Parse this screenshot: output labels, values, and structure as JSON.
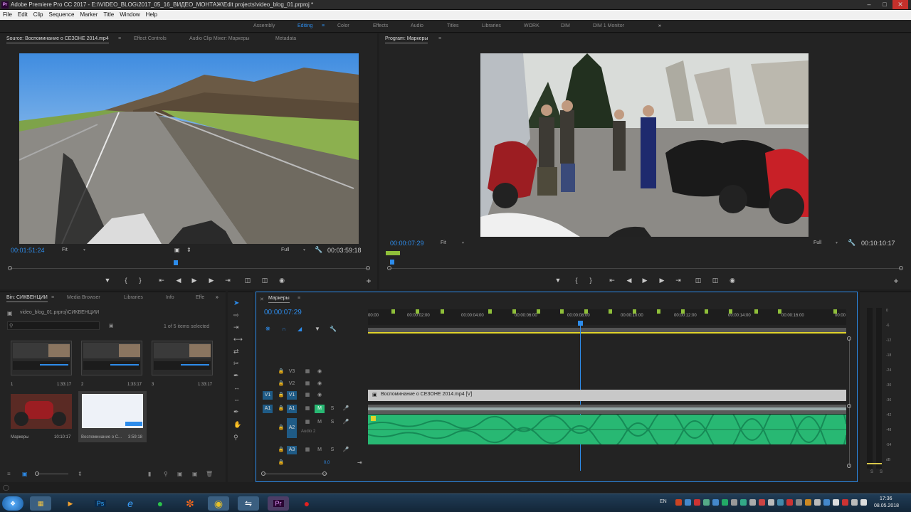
{
  "window": {
    "title": "Adobe Premiere Pro CC 2017 - E:\\\\VIDEO_BLOG\\2017_05_16_ВИДЕО_МОНТАЖ\\Edit projects\\video_blog_01.prproj *"
  },
  "menu": [
    "File",
    "Edit",
    "Clip",
    "Sequence",
    "Marker",
    "Title",
    "Window",
    "Help"
  ],
  "workspaces": [
    "Assembly",
    "Editing",
    "Color",
    "Effects",
    "Audio",
    "Titles",
    "Libraries",
    "WORK",
    "DIM",
    "DIM 1 Monitor"
  ],
  "source": {
    "tabs": [
      "Source: Воспоминание о СЕЗОНЕ 2014.mp4",
      "Effect Controls",
      "Audio Clip Mixer: Маркеры",
      "Metadata"
    ],
    "timecode": "00:01:51:24",
    "fit": "Fit",
    "quality": "Full",
    "duration": "00:03:59:18"
  },
  "program": {
    "tab": "Program: Маркеры",
    "timecode": "00:00:07:29",
    "fit": "Fit",
    "quality": "Full",
    "duration": "00:10:10:17"
  },
  "bin": {
    "tabs": [
      "Bin: СИКВЕНЦИИ",
      "Media Browser",
      "Libraries",
      "Info",
      "Effe"
    ],
    "path": "video_blog_01.prproj\\СИКВЕНЦИИ",
    "selected": "1 of 5 items selected",
    "items": [
      {
        "name": "1",
        "duration": "1:33:17"
      },
      {
        "name": "2",
        "duration": "1:33:17"
      },
      {
        "name": "3",
        "duration": "1:33:17"
      },
      {
        "name": "Маркеры",
        "duration": "10:10:17"
      },
      {
        "name": "Воспоминание о С...",
        "duration": "3:59:18"
      }
    ]
  },
  "timeline": {
    "tab": "Маркеры",
    "timecode": "00:00:07:29",
    "ruler": [
      "00:00",
      "00:00:02:00",
      "00:00:04:00",
      "00:00:06:00",
      "00:00:08:00",
      "00:00:10:00",
      "00:00:12:00",
      "00:00:14:00",
      "00:00:16:00",
      "00:00"
    ],
    "video_tracks": [
      "V3",
      "V2",
      "V1"
    ],
    "audio_tracks": [
      "A1",
      "A2",
      "A3"
    ],
    "v1_src": "V1",
    "a1_src": "A1",
    "clip_name": "Воспоминание о СЕЗОНЕ 2014.mp4 [V]",
    "audio2_name": "Audio 2",
    "m_label": "M",
    "s_label": "S",
    "master_value": "0,0"
  },
  "meter": {
    "scale": [
      "0",
      "-6",
      "-12",
      "-18",
      "-24",
      "-30",
      "-36",
      "-42",
      "-48",
      "-54",
      "dB"
    ],
    "solo": [
      "S",
      "S"
    ]
  },
  "taskbar": {
    "lang": "EN",
    "time": "17:36",
    "date": "08.05.2018"
  },
  "colors": {
    "accent": "#2d8ceb",
    "audio_wave": "#28b873",
    "clip": "#c8c8c8",
    "marker": "#8fbf3a",
    "work_area": "#e0d32a"
  }
}
